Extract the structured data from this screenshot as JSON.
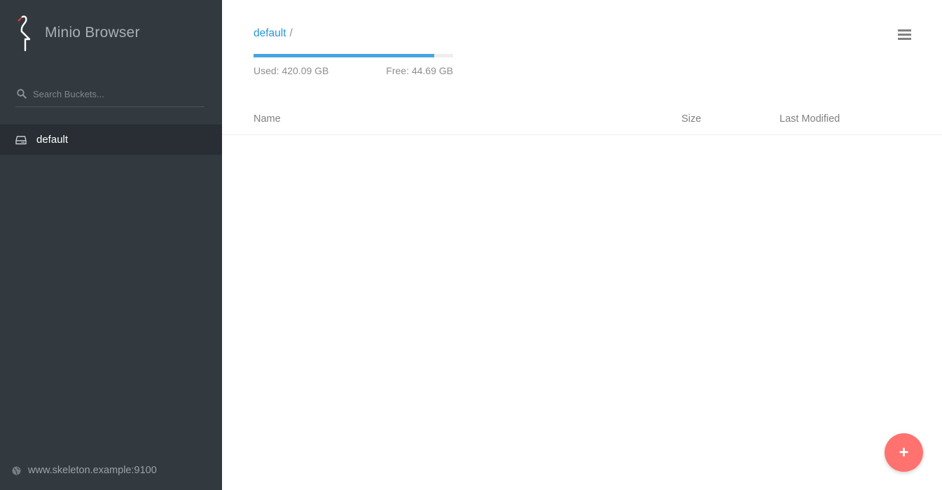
{
  "app": {
    "title": "Minio Browser",
    "host": "www.skeleton.example:9100"
  },
  "sidebar": {
    "search_placeholder": "Search Buckets...",
    "buckets": [
      {
        "label": "default",
        "active": true
      }
    ]
  },
  "breadcrumb": {
    "bucket": "default",
    "separator": "/"
  },
  "storage": {
    "used_label": "Used: 420.09 GB",
    "free_label": "Free: 44.69 GB",
    "used_fraction": 0.904
  },
  "table": {
    "columns": [
      "Name",
      "Size",
      "Last Modified"
    ],
    "rows": []
  },
  "icons": {
    "logo": "minio-flamingo-logo",
    "search": "search-icon",
    "bucket": "hard-drive-icon",
    "host": "globe-icon",
    "menu": "hamburger-menu-icon",
    "fab": "plus-icon"
  },
  "colors": {
    "sidebar_bg": "#32393f",
    "accent": "#2895d9",
    "progress": "#46a5e0",
    "fab": "#ff726f"
  }
}
